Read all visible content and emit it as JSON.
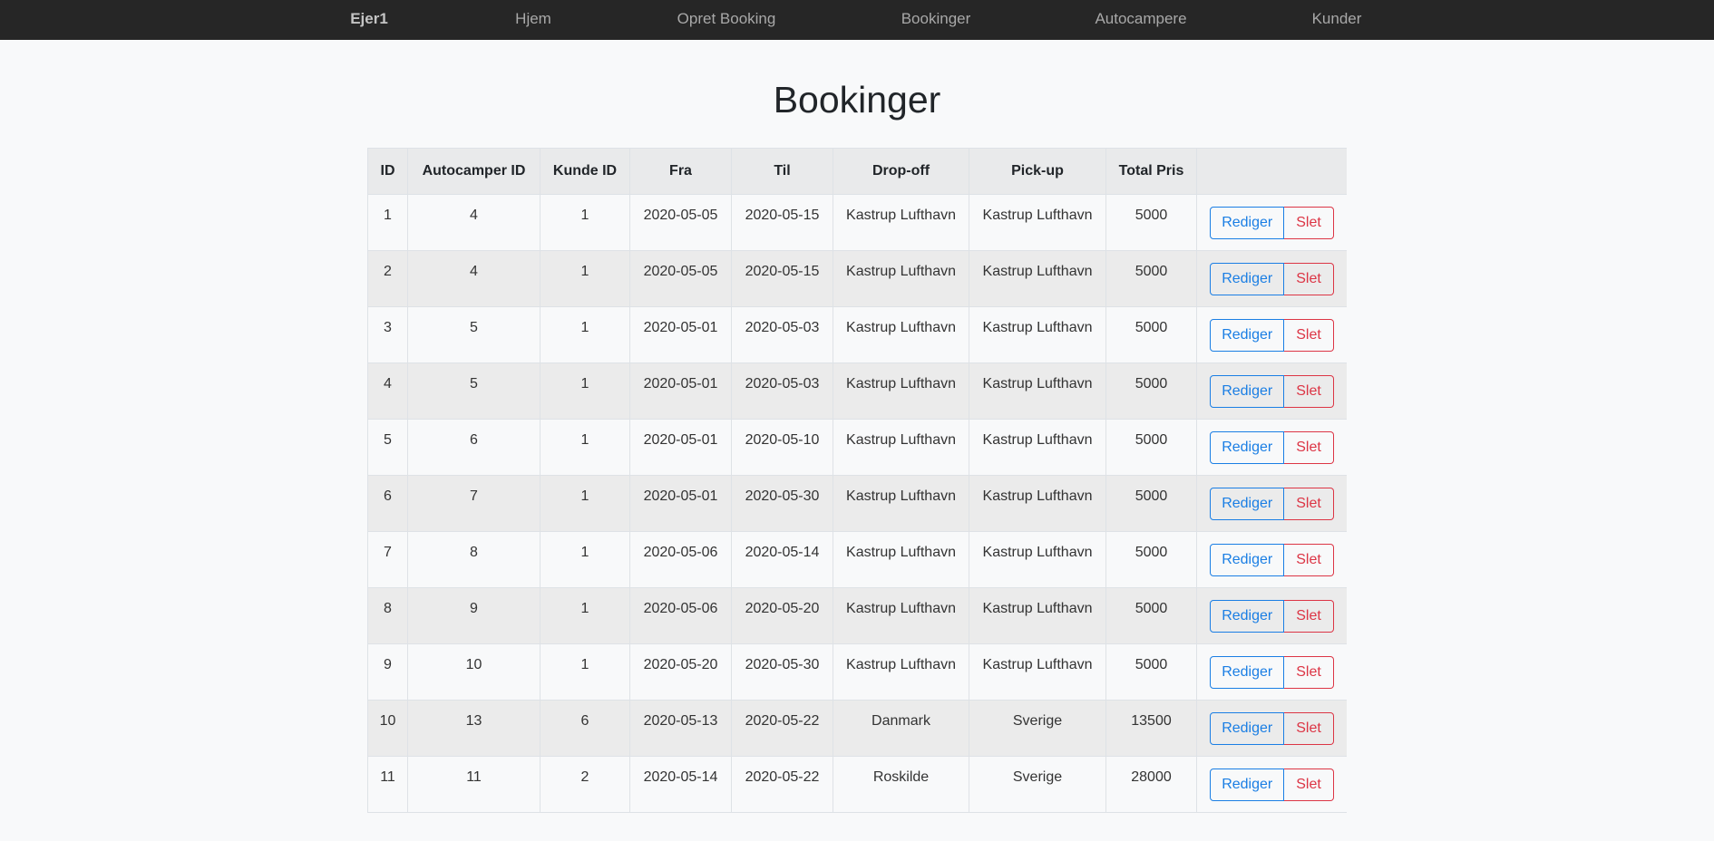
{
  "nav": {
    "brand": "Ejer1",
    "links": [
      "Hjem",
      "Opret Booking",
      "Bookinger",
      "Autocampere",
      "Kunder"
    ]
  },
  "page": {
    "title": "Bookinger"
  },
  "table": {
    "headers": [
      "ID",
      "Autocamper ID",
      "Kunde ID",
      "Fra",
      "Til",
      "Drop-off",
      "Pick-up",
      "Total Pris",
      ""
    ],
    "edit_label": "Rediger",
    "delete_label": "Slet",
    "rows": [
      [
        "1",
        "4",
        "1",
        "2020-05-05",
        "2020-05-15",
        "Kastrup Lufthavn",
        "Kastrup Lufthavn",
        "5000"
      ],
      [
        "2",
        "4",
        "1",
        "2020-05-05",
        "2020-05-15",
        "Kastrup Lufthavn",
        "Kastrup Lufthavn",
        "5000"
      ],
      [
        "3",
        "5",
        "1",
        "2020-05-01",
        "2020-05-03",
        "Kastrup Lufthavn",
        "Kastrup Lufthavn",
        "5000"
      ],
      [
        "4",
        "5",
        "1",
        "2020-05-01",
        "2020-05-03",
        "Kastrup Lufthavn",
        "Kastrup Lufthavn",
        "5000"
      ],
      [
        "5",
        "6",
        "1",
        "2020-05-01",
        "2020-05-10",
        "Kastrup Lufthavn",
        "Kastrup Lufthavn",
        "5000"
      ],
      [
        "6",
        "7",
        "1",
        "2020-05-01",
        "2020-05-30",
        "Kastrup Lufthavn",
        "Kastrup Lufthavn",
        "5000"
      ],
      [
        "7",
        "8",
        "1",
        "2020-05-06",
        "2020-05-14",
        "Kastrup Lufthavn",
        "Kastrup Lufthavn",
        "5000"
      ],
      [
        "8",
        "9",
        "1",
        "2020-05-06",
        "2020-05-20",
        "Kastrup Lufthavn",
        "Kastrup Lufthavn",
        "5000"
      ],
      [
        "9",
        "10",
        "1",
        "2020-05-20",
        "2020-05-30",
        "Kastrup Lufthavn",
        "Kastrup Lufthavn",
        "5000"
      ],
      [
        "10",
        "13",
        "6",
        "2020-05-13",
        "2020-05-22",
        "Danmark",
        "Sverige",
        "13500"
      ],
      [
        "11",
        "11",
        "2",
        "2020-05-14",
        "2020-05-22",
        "Roskilde",
        "Sverige",
        "28000"
      ]
    ]
  },
  "colors": {
    "navbar_bg": "#262626",
    "page_bg": "#f8f9fa",
    "edit_accent": "#1a7ee4",
    "delete_accent": "#dc3545"
  }
}
